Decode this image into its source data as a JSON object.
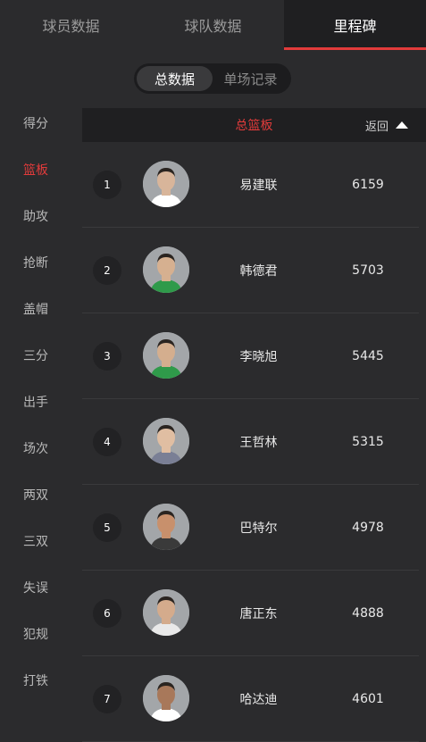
{
  "tabs": [
    {
      "label": "球员数据"
    },
    {
      "label": "球队数据"
    },
    {
      "label": "里程碑"
    }
  ],
  "segment": {
    "items": [
      "总数据",
      "单场记录"
    ]
  },
  "sidebar": {
    "items": [
      "得分",
      "篮板",
      "助攻",
      "抢断",
      "盖帽",
      "三分",
      "出手",
      "场次",
      "两双",
      "三双",
      "失误",
      "犯规",
      "打铁"
    ],
    "active_index": 1
  },
  "list": {
    "title": "总篮板",
    "back_label": "返回",
    "rows": [
      {
        "rank": "1",
        "name": "易建联",
        "value": "6159",
        "jersey": "#ffffff",
        "skin": "#d8b59a"
      },
      {
        "rank": "2",
        "name": "韩德君",
        "value": "5703",
        "jersey": "#2f9a4a",
        "skin": "#d6b090"
      },
      {
        "rank": "3",
        "name": "李晓旭",
        "value": "5445",
        "jersey": "#2f9a4a",
        "skin": "#d4ae8e"
      },
      {
        "rank": "4",
        "name": "王哲林",
        "value": "5315",
        "jersey": "#7a7f95",
        "skin": "#e0bea2"
      },
      {
        "rank": "5",
        "name": "巴特尔",
        "value": "4978",
        "jersey": "#3a3a3a",
        "skin": "#c8906c"
      },
      {
        "rank": "6",
        "name": "唐正东",
        "value": "4888",
        "jersey": "#e9e9e9",
        "skin": "#d4ab8c"
      },
      {
        "rank": "7",
        "name": "哈达迪",
        "value": "4601",
        "jersey": "#ffffff",
        "skin": "#a8785a"
      }
    ]
  },
  "colors": {
    "accent": "#e23b3b",
    "background": "#2b2b2d",
    "header_bg": "#1f1f21"
  }
}
